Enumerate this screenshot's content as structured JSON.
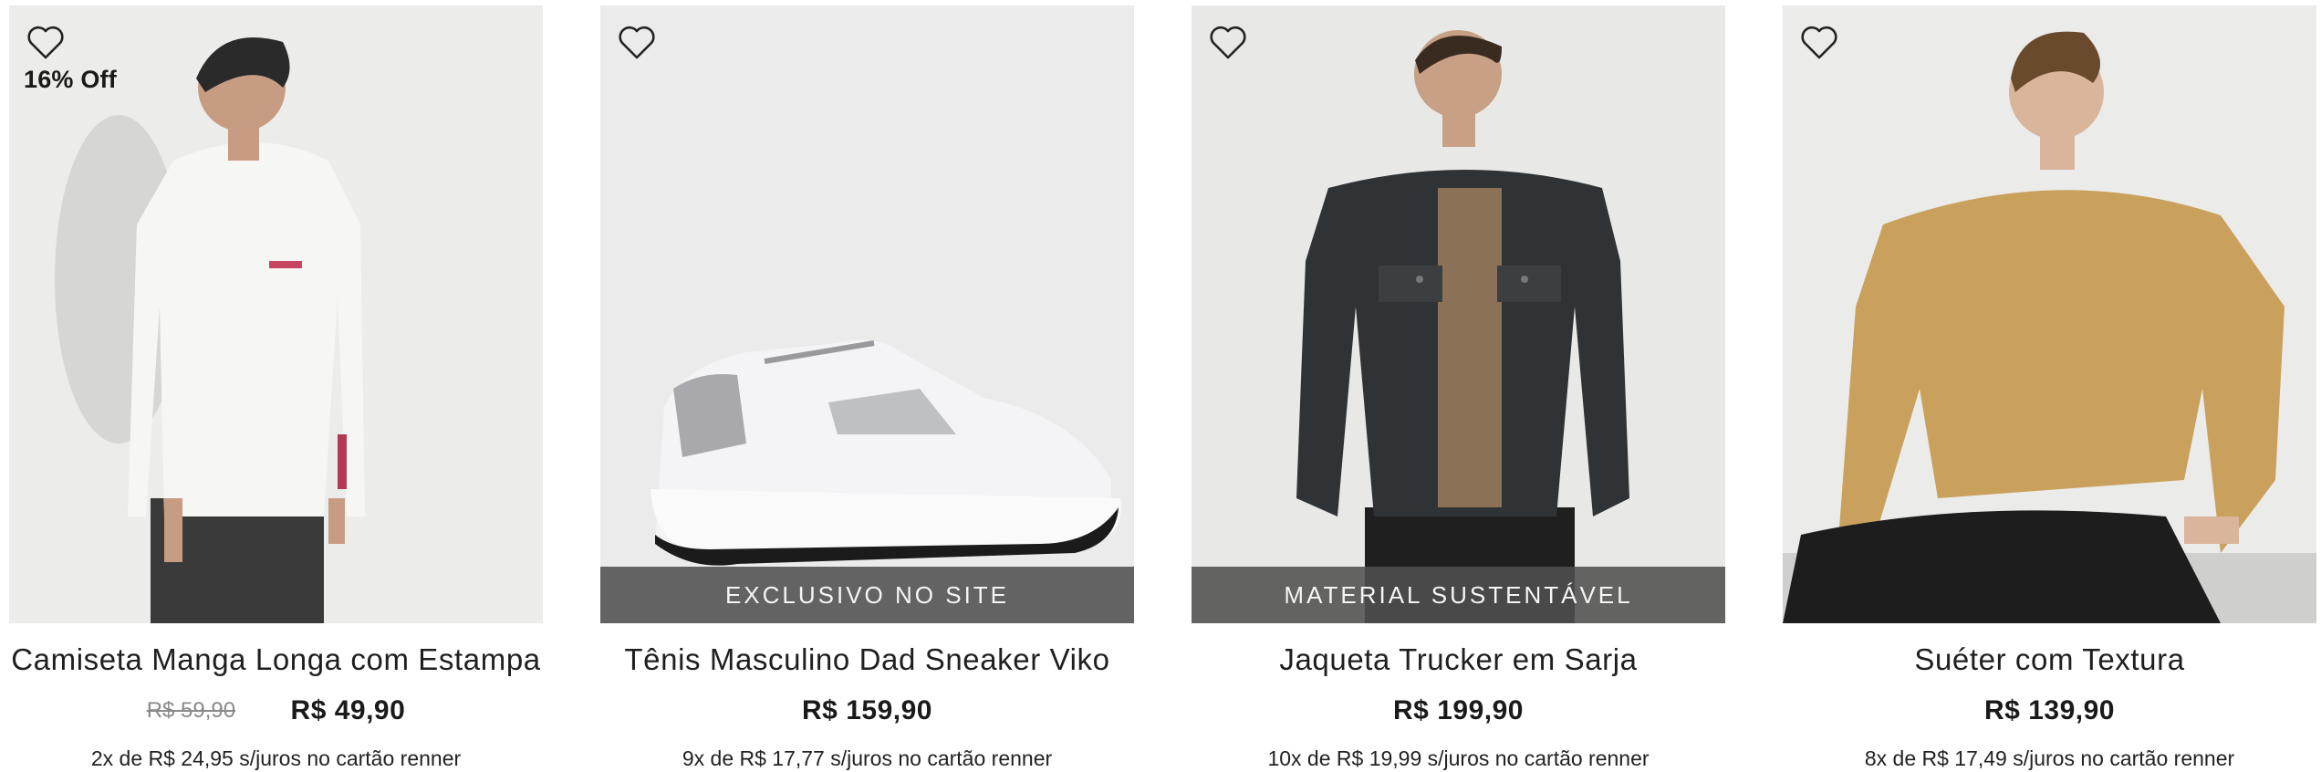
{
  "colors": {
    "background": "#ffffff",
    "ribbon": "#505050",
    "text": "#1f1f1f",
    "old_price": "#8a8a8a"
  },
  "products": [
    {
      "favorite_icon": "heart-outline-icon",
      "discount_badge": "16% Off",
      "ribbon": "",
      "name": "Camiseta Manga Longa com Estampa",
      "old_price": "R$ 59,90",
      "price": "R$ 49,90",
      "installments": "2x de R$ 24,95 s/juros no cartão renner"
    },
    {
      "favorite_icon": "heart-outline-icon",
      "discount_badge": "",
      "ribbon": "EXCLUSIVO NO SITE",
      "name": "Tênis Masculino Dad Sneaker Viko",
      "old_price": "",
      "price": "R$ 159,90",
      "installments": "9x de R$ 17,77 s/juros no cartão renner"
    },
    {
      "favorite_icon": "heart-outline-icon",
      "discount_badge": "",
      "ribbon": "MATERIAL SUSTENTÁVEL",
      "name": "Jaqueta Trucker em Sarja",
      "old_price": "",
      "price": "R$ 199,90",
      "installments": "10x de R$ 19,99 s/juros no cartão renner"
    },
    {
      "favorite_icon": "heart-outline-icon",
      "discount_badge": "",
      "ribbon": "",
      "name": "Suéter com Textura",
      "old_price": "",
      "price": "R$ 139,90",
      "installments": "8x de R$ 17,49 s/juros no cartão renner"
    }
  ]
}
